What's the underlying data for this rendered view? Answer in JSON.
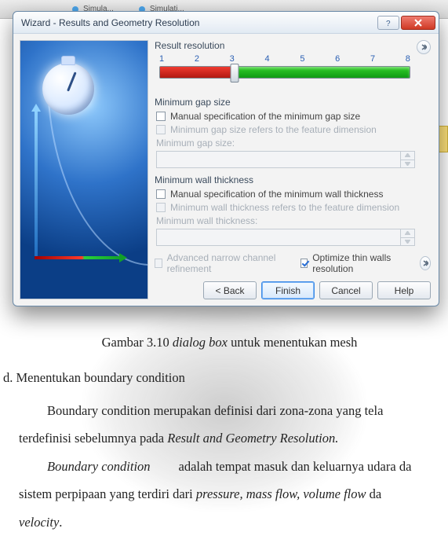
{
  "tabs": {
    "t1": "Simula...",
    "t2": "Simulati..."
  },
  "dialog": {
    "title": "Wizard - Results and Geometry Resolution",
    "result_resolution": {
      "label": "Result resolution",
      "ticks": [
        "1",
        "2",
        "3",
        "4",
        "5",
        "6",
        "7",
        "8"
      ]
    },
    "min_gap": {
      "title": "Minimum gap size",
      "manual": "Manual specification of the minimum gap size",
      "refers": "Minimum gap size refers to the feature dimension",
      "field_label": "Minimum gap size:",
      "value": ""
    },
    "min_wall": {
      "title": "Minimum wall thickness",
      "manual": "Manual specification of the minimum wall thickness",
      "refers": "Minimum wall thickness refers to the feature dimension",
      "field_label": "Minimum wall thickness:",
      "value": ""
    },
    "adv": {
      "narrow": "Advanced narrow channel refinement",
      "optimize": "Optimize thin walls resolution"
    },
    "buttons": {
      "back": "< Back",
      "finish": "Finish",
      "cancel": "Cancel",
      "help": "Help"
    }
  },
  "doc": {
    "caption_pre": "Gambar 3.10 ",
    "caption_it": "dialog box",
    "caption_post": "  untuk menentukan mesh",
    "section": "d.   Menentukan boundary condition",
    "p1a": "Boundary condition merupakan definisi dari zona-zona yang tela",
    "p1b": "terdefinisi sebelumnya pada ",
    "p1b_it": "Result and Geometry Resolution.",
    "p2a_it": "Boundary condition",
    "p2a": " adalah tempat masuk dan keluarnya udara da",
    "p2b": "sistem perpipaan yang terdiri dari ",
    "p2b_it": "pressure, mass flow, volume flow",
    "p2b2": " da",
    "p2c_it": "velocity",
    "p2c": "."
  }
}
